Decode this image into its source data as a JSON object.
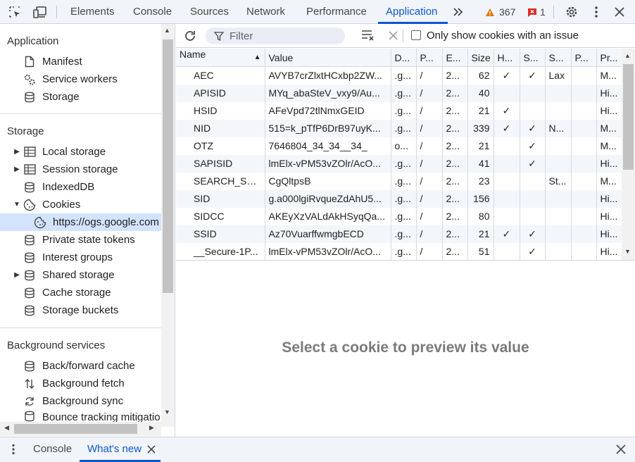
{
  "toolbar": {
    "tabs": [
      {
        "label": "Elements"
      },
      {
        "label": "Console"
      },
      {
        "label": "Sources"
      },
      {
        "label": "Network"
      },
      {
        "label": "Performance"
      },
      {
        "label": "Application",
        "active": true
      }
    ],
    "warnings_count": "367",
    "errors_count": "1",
    "icons": [
      "inspect-icon",
      "device-toggle-icon",
      "more-tabs-icon",
      "warning-icon",
      "error-icon",
      "gear-icon",
      "kebab-menu-icon",
      "close-icon"
    ]
  },
  "sidebar": {
    "application": {
      "title": "Application",
      "items": [
        "Manifest",
        "Service workers",
        "Storage"
      ]
    },
    "storage": {
      "title": "Storage",
      "items": [
        {
          "label": "Local storage"
        },
        {
          "label": "Session storage"
        },
        {
          "label": "IndexedDB"
        },
        {
          "label": "Cookies"
        },
        {
          "label": "https://ogs.google.com"
        },
        {
          "label": "Private state tokens"
        },
        {
          "label": "Interest groups"
        },
        {
          "label": "Shared storage"
        },
        {
          "label": "Cache storage"
        },
        {
          "label": "Storage buckets"
        }
      ]
    },
    "background": {
      "title": "Background services",
      "items": [
        "Back/forward cache",
        "Background fetch",
        "Background sync",
        "Bounce tracking mitigatio"
      ]
    }
  },
  "filter": {
    "placeholder": "Filter",
    "only_issues_label": "Only show cookies with an issue"
  },
  "cookies": {
    "columns": [
      "Name",
      "Value",
      "D...",
      "P...",
      "E...",
      "Size",
      "H...",
      "S...",
      "S...",
      "P...",
      "Pr..."
    ],
    "rows": [
      [
        "AEC",
        "AVYB7crZlxtHCxbp2ZW...",
        ".g...",
        "/",
        "2...",
        "62",
        "✓",
        "✓",
        "Lax",
        "",
        "M..."
      ],
      [
        "APISID",
        "MYq_abaSteV_vxy9/Au...",
        ".g...",
        "/",
        "2...",
        "40",
        "",
        "",
        "",
        "",
        "Hi..."
      ],
      [
        "HSID",
        "AFeVpd72tlNmxGEID",
        ".g...",
        "/",
        "2...",
        "21",
        "✓",
        "",
        "",
        "",
        "Hi..."
      ],
      [
        "NID",
        "515=k_pTfP6DrB97uyK...",
        ".g...",
        "/",
        "2...",
        "339",
        "✓",
        "✓",
        "N...",
        "",
        "M..."
      ],
      [
        "OTZ",
        "7646804_34_34__34_",
        "o...",
        "/",
        "2...",
        "21",
        "",
        "✓",
        "",
        "",
        "M..."
      ],
      [
        "SAPISID",
        "lmElx-vPM53vZOlr/AcO...",
        ".g...",
        "/",
        "2...",
        "41",
        "",
        "✓",
        "",
        "",
        "Hi..."
      ],
      [
        "SEARCH_SA...",
        "CgQltpsB",
        ".g...",
        "/",
        "2...",
        "23",
        "",
        "",
        "St...",
        "",
        "M..."
      ],
      [
        "SID",
        "g.a000lgiRvqueZdAhU5...",
        ".g...",
        "/",
        "2...",
        "156",
        "",
        "",
        "",
        "",
        "Hi..."
      ],
      [
        "SIDCC",
        "AKEyXzVALdAkHSyqQa...",
        ".g...",
        "/",
        "2...",
        "80",
        "",
        "",
        "",
        "",
        "Hi..."
      ],
      [
        "SSID",
        "Az70VuarffwmgbECD",
        ".g...",
        "/",
        "2...",
        "21",
        "✓",
        "✓",
        "",
        "",
        "Hi..."
      ],
      [
        "__Secure-1P...",
        "lmElx-vPM53vZOlr/AcO...",
        ".g...",
        "/",
        "2...",
        "51",
        "",
        "✓",
        "",
        "",
        "Hi..."
      ]
    ]
  },
  "preview_message": "Select a cookie to preview its value",
  "drawer": {
    "tabs": [
      {
        "label": "Console"
      },
      {
        "label": "What's new",
        "active": true
      }
    ]
  },
  "colors": {
    "accent": "#0b57d0",
    "selected_bg": "#d3e3fd",
    "warning": "#e37400",
    "error": "#d93025"
  }
}
